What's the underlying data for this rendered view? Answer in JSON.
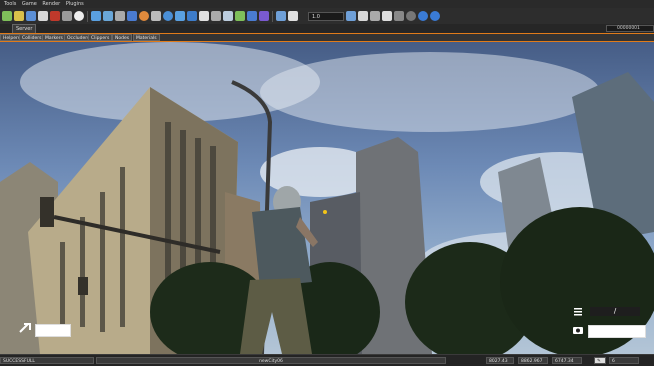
{
  "menu": [
    "Tools",
    "Game",
    "Render",
    "Plugins"
  ],
  "toolbar": {
    "zoom_value": "1.0",
    "icons": [
      "new-icon",
      "open-icon",
      "save-icon",
      "undo-icon",
      "redo-icon",
      "link-icon",
      "unlink-icon",
      "select-icon",
      "move-icon",
      "rotate-icon",
      "scale-icon",
      "snap-icon",
      "terrain-icon",
      "material-icon",
      "fx-icon",
      "physics-icon",
      "entity-icon",
      "camera-icon",
      "text-icon",
      "game-icon",
      "grid-icon",
      "light-icon",
      "sound-icon",
      "help-icon"
    ]
  },
  "tabs": [
    "Server"
  ],
  "filters": [
    "Helpers",
    "Colliders",
    "Markers",
    "Occluders",
    "Clippers",
    "Nodes",
    "Materials"
  ],
  "status": {
    "left": "SUCCESSFULL",
    "center": "newCity06",
    "x": "8027.43",
    "y": "8862.967",
    "z": "6747.34",
    "speed": "6"
  },
  "coord_box": "00000001"
}
